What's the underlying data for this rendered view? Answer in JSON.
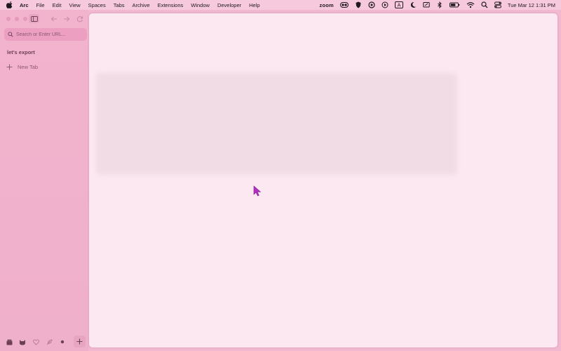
{
  "menubar": {
    "app": "Arc",
    "menus": [
      "File",
      "Edit",
      "View",
      "Spaces",
      "Tabs",
      "Archive",
      "Extensions",
      "Window",
      "Developer",
      "Help"
    ],
    "zoom_label": "zoom",
    "clock": "Tue Mar 12  1:31 PM",
    "icons": [
      "apple-icon",
      "zoom-meter-icon",
      "shield-icon",
      "chat-icon",
      "play-icon",
      "a-keyboard-icon",
      "moon-icon",
      "screen-share-icon",
      "bluetooth-icon",
      "battery-icon",
      "wifi-icon",
      "search-icon",
      "control-center-icon"
    ]
  },
  "sidebar": {
    "url_placeholder": "Search or Enter URL...",
    "space_title": "let's export",
    "new_tab_label": "New Tab",
    "bottom_icons": [
      "archive-icon",
      "cat-space-icon",
      "heart-space-icon",
      "feather-space-icon",
      "dot-space-icon",
      "add-space-icon"
    ]
  },
  "colors": {
    "sidebar": "#f1b8d0",
    "content": "#fbe8f0",
    "cursor": "#b42fc4"
  }
}
